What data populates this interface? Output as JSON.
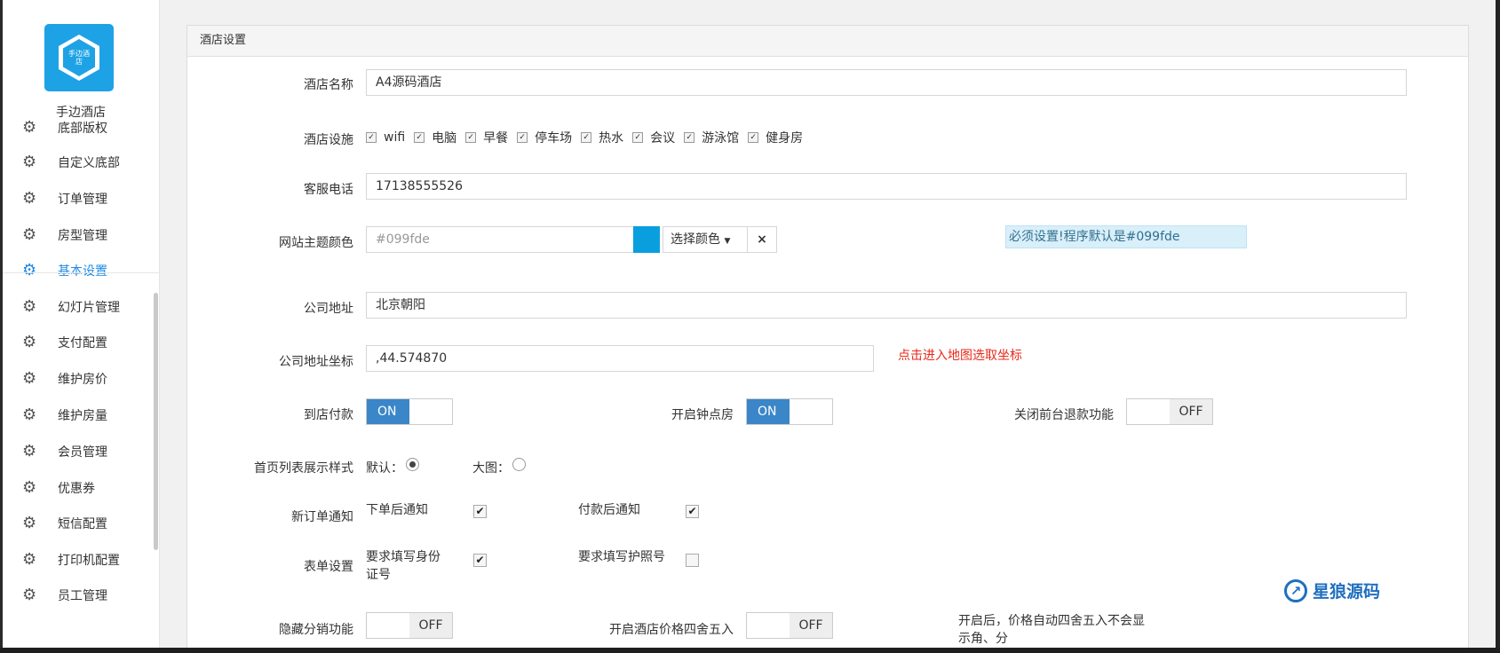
{
  "brand": {
    "logo_text": "手边酒店",
    "name": "手边酒店"
  },
  "sidebar": {
    "items": [
      {
        "label": "底部版权"
      },
      {
        "label": "自定义底部"
      },
      {
        "label": "订单管理"
      },
      {
        "label": "房型管理"
      },
      {
        "label": "基本设置",
        "active": true
      },
      {
        "label": "幻灯片管理"
      },
      {
        "label": "支付配置"
      },
      {
        "label": "维护房价"
      },
      {
        "label": "维护房量"
      },
      {
        "label": "会员管理"
      },
      {
        "label": "优惠券"
      },
      {
        "label": "短信配置"
      },
      {
        "label": "打印机配置"
      },
      {
        "label": "员工管理"
      }
    ]
  },
  "panel": {
    "title": "酒店设置"
  },
  "form": {
    "hotel_name": {
      "label": "酒店名称",
      "value": "A4源码酒店"
    },
    "facilities": {
      "label": "酒店设施",
      "items": [
        "wifi",
        "电脑",
        "早餐",
        "停车场",
        "热水",
        "会议",
        "游泳馆",
        "健身房"
      ]
    },
    "phone": {
      "label": "客服电话",
      "value": "17138555526"
    },
    "theme_color": {
      "label": "网站主题颜色",
      "placeholder": "#099fde",
      "swatch": "#099fde",
      "select_label": "选择颜色",
      "clear": "×",
      "hint": "必须设置!程序默认是#099fde"
    },
    "address": {
      "label": "公司地址",
      "value": "北京朝阳"
    },
    "coords": {
      "label": "公司地址坐标",
      "value": ",44.574870",
      "map_link": "点击进入地图选取坐标"
    },
    "pay_at_store": {
      "label": "到店付款",
      "state": "ON"
    },
    "hourly_room": {
      "label": "开启钟点房",
      "state": "ON"
    },
    "refund_off": {
      "label": "关闭前台退款功能",
      "state": "OFF"
    },
    "list_style": {
      "label": "首页列表展示样式",
      "option1": "默认：",
      "option2": "大图："
    },
    "new_order_notify": {
      "label": "新订单通知",
      "option1": "下单后通知",
      "option2": "付款后通知"
    },
    "form_settings": {
      "label": "表单设置",
      "option1": "要求填写身份证号",
      "option2": "要求填写护照号"
    },
    "hide_distribution": {
      "label": "隐藏分销功能",
      "state": "OFF"
    },
    "round_price": {
      "label": "开启酒店价格四舍五入",
      "state": "OFF",
      "note": "开启后，价格自动四舍五入不会显示角、分"
    }
  },
  "watermark": {
    "text": "星狼源码"
  }
}
